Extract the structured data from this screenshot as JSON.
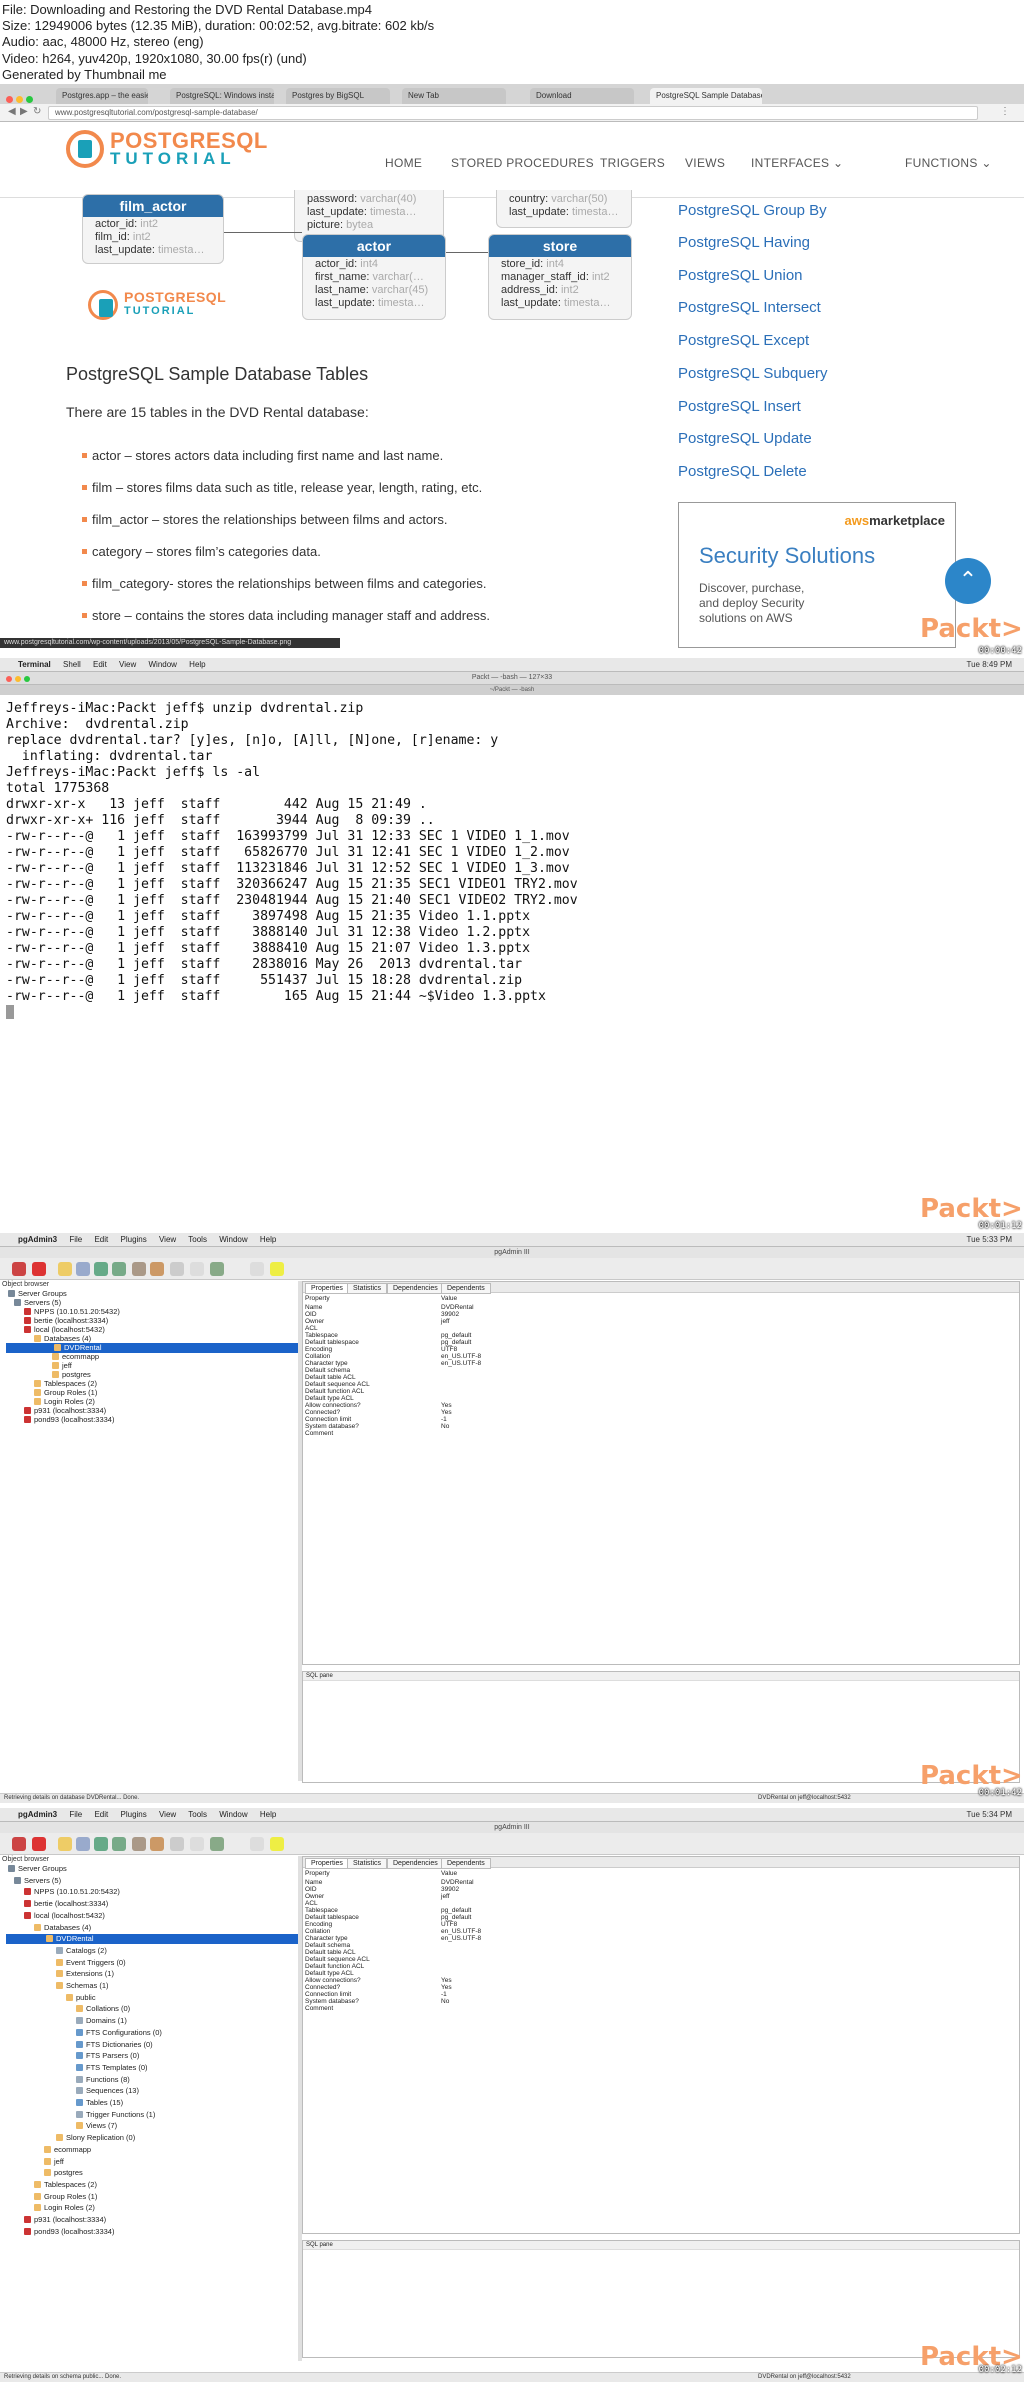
{
  "info": {
    "lines": [
      "File: Downloading and Restoring the DVD Rental Database.mp4",
      "Size: 12949006 bytes (12.35 MiB), duration: 00:02:52, avg.bitrate: 602 kb/s",
      "Audio: aac, 48000 Hz, stereo (eng)",
      "Video: h264, yuv420p, 1920x1080, 30.00 fps(r) (und)",
      "Generated by Thumbnail me"
    ]
  },
  "timestamps": [
    "00:00:42",
    "00:01:12",
    "00:01:42",
    "00:02:12"
  ],
  "watermark": "Packt>",
  "browser": {
    "tabs": [
      "Postgres.app – the easiest wa…",
      "PostgreSQL: Windows install…",
      "Postgres by BigSQL",
      "New Tab",
      "Download",
      "PostgreSQL Sample Database"
    ],
    "url": "www.postgresqltutorial.com/postgresql-sample-database/",
    "status_url": "www.postgresqltutorial.com/wp-content/uploads/2013/05/PostgreSQL-Sample-Database.png",
    "logo_top": "POSTGRESQL",
    "logo_bottom": "TUTORIAL",
    "menu": [
      "HOME",
      "STORED PROCEDURES",
      "TRIGGERS",
      "VIEWS",
      "INTERFACES ⌄",
      "FUNCTIONS ⌄"
    ],
    "erd": {
      "film_actor": {
        "title": "film_actor",
        "rows": [
          [
            "actor_id",
            "int2"
          ],
          [
            "film_id",
            "int2"
          ],
          [
            "last_update",
            "timesta…"
          ]
        ]
      },
      "staff_partial": {
        "rows": [
          [
            "password",
            "varchar(40)"
          ],
          [
            "last_update",
            "timesta…"
          ],
          [
            "picture",
            "bytea"
          ]
        ]
      },
      "address_partial": {
        "rows": [
          [
            "country",
            "varchar(50)"
          ],
          [
            "last_update",
            "timesta…"
          ]
        ]
      },
      "actor": {
        "title": "actor",
        "rows": [
          [
            "actor_id",
            "int4"
          ],
          [
            "first_name",
            "varchar(…"
          ],
          [
            "last_name",
            "varchar(45)"
          ],
          [
            "last_update",
            "timesta…"
          ]
        ]
      },
      "store": {
        "title": "store",
        "rows": [
          [
            "store_id",
            "int4"
          ],
          [
            "manager_staff_id",
            "int2"
          ],
          [
            "address_id",
            "int2"
          ],
          [
            "last_update",
            "timesta…"
          ]
        ]
      }
    },
    "heading": "PostgreSQL Sample Database Tables",
    "intro": "There are 15 tables in the DVD Rental database:",
    "bullets": [
      "actor – stores actors data including first name and last name.",
      "film – stores films data such as title, release year, length, rating, etc.",
      "film_actor – stores the relationships between films and actors.",
      "category – stores film’s categories data.",
      "film_category- stores the relationships between films and categories.",
      "store – contains the stores data including manager staff and address."
    ],
    "sidebar_links": [
      "PostgreSQL Group By",
      "PostgreSQL Having",
      "PostgreSQL Union",
      "PostgreSQL Intersect",
      "PostgreSQL Except",
      "PostgreSQL Subquery",
      "PostgreSQL Insert",
      "PostgreSQL Update",
      "PostgreSQL Delete"
    ],
    "ad": {
      "brand_a": "aws",
      "brand_b": "marketplace",
      "title": "Security Solutions",
      "lines": [
        "Discover, purchase,",
        "and deploy Security",
        "solutions on AWS"
      ]
    }
  },
  "terminal": {
    "menu": [
      "Terminal",
      "Shell",
      "Edit",
      "View",
      "Window",
      "Help"
    ],
    "clock": "Tue 8:49 PM",
    "title": "Packt — -bash — 127×33",
    "tab": "~/Packt — -bash",
    "lines": [
      "Jeffreys-iMac:Packt jeff$ unzip dvdrental.zip",
      "Archive:  dvdrental.zip",
      "replace dvdrental.tar? [y]es, [n]o, [A]ll, [N]one, [r]ename: y",
      "  inflating: dvdrental.tar",
      "Jeffreys-iMac:Packt jeff$ ls -al",
      "total 1775368",
      "drwxr-xr-x   13 jeff  staff        442 Aug 15 21:49 .",
      "drwxr-xr-x+ 116 jeff  staff       3944 Aug  8 09:39 ..",
      "-rw-r--r--@   1 jeff  staff  163993799 Jul 31 12:33 SEC 1 VIDEO 1_1.mov",
      "-rw-r--r--@   1 jeff  staff   65826770 Jul 31 12:41 SEC 1 VIDEO 1_2.mov",
      "-rw-r--r--@   1 jeff  staff  113231846 Jul 31 12:52 SEC 1 VIDEO 1_3.mov",
      "-rw-r--r--@   1 jeff  staff  320366247 Aug 15 21:35 SEC1 VIDEO1 TRY2.mov",
      "-rw-r--r--@   1 jeff  staff  230481944 Aug 15 21:40 SEC1 VIDEO2 TRY2.mov",
      "-rw-r--r--@   1 jeff  staff    3897498 Aug 15 21:35 Video 1.1.pptx",
      "-rw-r--r--@   1 jeff  staff    3888140 Jul 31 12:38 Video 1.2.pptx",
      "-rw-r--r--@   1 jeff  staff    3888410 Aug 15 21:07 Video 1.3.pptx",
      "-rw-r--r--@   1 jeff  staff    2838016 May 26  2013 dvdrental.tar",
      "-rw-r--r--@   1 jeff  staff     551437 Jul 15 18:28 dvdrental.zip",
      "-rw-r--r--@   1 jeff  staff        165 Aug 15 21:44 ~$Video 1.3.pptx"
    ]
  },
  "pgadmin1": {
    "menu": [
      "pgAdmin3",
      "File",
      "Edit",
      "Plugins",
      "View",
      "Tools",
      "Window",
      "Help"
    ],
    "clock": "Tue 5:33 PM",
    "window_title": "pgAdmin III",
    "object_browser": "Object browser",
    "tree": [
      "Server Groups",
      "Servers (5)",
      "NPPS (10.10.51.20:5432)",
      "bertie (localhost:3334)",
      "local (localhost:5432)",
      "Databases (4)",
      "DVDRental",
      "ecommapp",
      "jeff",
      "postgres",
      "Tablespaces (2)",
      "Group Roles (1)",
      "Login Roles (2)",
      "p931 (localhost:3334)",
      "pond93 (localhost:3334)"
    ],
    "tabs": [
      "Properties",
      "Statistics",
      "Dependencies",
      "Dependents"
    ],
    "prop_header": [
      "Property",
      "Value"
    ],
    "props": [
      [
        "Name",
        "DVDRental"
      ],
      [
        "OID",
        "39902"
      ],
      [
        "Owner",
        "jeff"
      ],
      [
        "ACL",
        ""
      ],
      [
        "Tablespace",
        "pg_default"
      ],
      [
        "Default tablespace",
        "pg_default"
      ],
      [
        "Encoding",
        "UTF8"
      ],
      [
        "Collation",
        "en_US.UTF-8"
      ],
      [
        "Character type",
        "en_US.UTF-8"
      ],
      [
        "Default schema",
        ""
      ],
      [
        "Default table ACL",
        ""
      ],
      [
        "Default sequence ACL",
        ""
      ],
      [
        "Default function ACL",
        ""
      ],
      [
        "Default type ACL",
        ""
      ],
      [
        "Allow connections?",
        "Yes"
      ],
      [
        "Connected?",
        "Yes"
      ],
      [
        "Connection limit",
        "-1"
      ],
      [
        "System database?",
        "No"
      ],
      [
        "Comment",
        ""
      ]
    ],
    "sql_pane": "SQL pane",
    "status_left": "Retrieving details on database DVDRental... Done.",
    "status_right": "DVDRental on jeff@localhost:5432"
  },
  "pgadmin2": {
    "clock": "Tue 5:34 PM",
    "tree": [
      "Server Groups",
      "Servers (5)",
      "NPPS (10.10.51.20:5432)",
      "bertie (localhost:3334)",
      "local (localhost:5432)",
      "Databases (4)",
      "DVDRental",
      "Catalogs (2)",
      "Event Triggers (0)",
      "Extensions (1)",
      "Schemas (1)",
      "public",
      "Collations (0)",
      "Domains (1)",
      "FTS Configurations (0)",
      "FTS Dictionaries (0)",
      "FTS Parsers (0)",
      "FTS Templates (0)",
      "Functions (8)",
      "Sequences (13)",
      "Tables (15)",
      "Trigger Functions (1)",
      "Views (7)",
      "Slony Replication (0)",
      "ecommapp",
      "jeff",
      "postgres",
      "Tablespaces (2)",
      "Group Roles (1)",
      "Login Roles (2)",
      "p931 (localhost:3334)",
      "pond93 (localhost:3334)"
    ],
    "status_left": "Retrieving details on schema public... Done.",
    "status_right": "DVDRental on jeff@localhost:5432"
  }
}
